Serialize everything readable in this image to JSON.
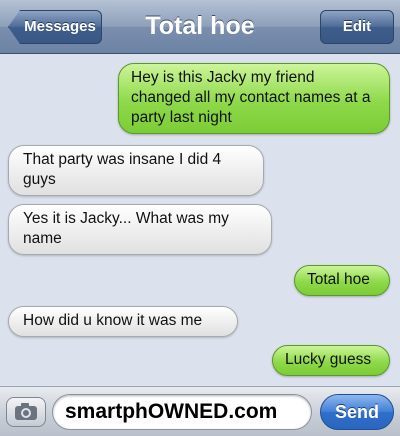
{
  "navbar": {
    "back_label": "Messages",
    "title": "Total hoe",
    "edit_label": "Edit"
  },
  "messages": [
    {
      "from": "me",
      "text": "Hey is this Jacky my friend changed all my contact names at a party last night"
    },
    {
      "from": "them",
      "text": "That party was insane I did 4 guys"
    },
    {
      "from": "them",
      "text": "Yes it is Jacky... What was my name"
    },
    {
      "from": "me",
      "text": "Total hoe"
    },
    {
      "from": "them",
      "text": "How did u know it was me"
    },
    {
      "from": "me",
      "text": "Lucky guess"
    }
  ],
  "input": {
    "field_text": "smartphOWNED.com",
    "send_label": "Send",
    "camera_icon": "camera-icon"
  },
  "colors": {
    "sent_bubble": "#8ed94a",
    "received_bubble": "#ececec",
    "background": "#dbe2ed",
    "send_button": "#3f7ed6"
  }
}
